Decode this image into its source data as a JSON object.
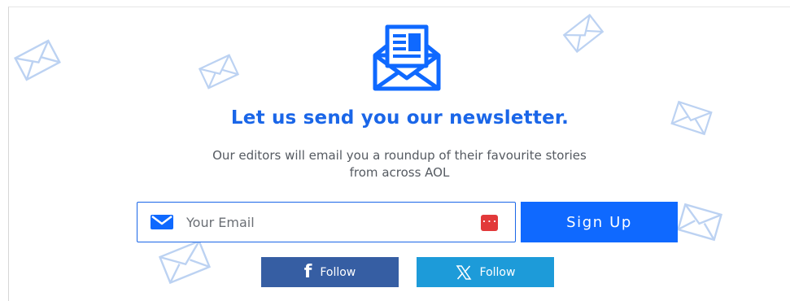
{
  "newsletter": {
    "title": "Let us send you our newsletter.",
    "description": "Our editors will email you a roundup of their favourite stories from across AOL",
    "email_placeholder": "Your Email",
    "password_manager_icon": "dots-icon",
    "signup_label": "Sign Up"
  },
  "social": {
    "facebook_label": "Follow",
    "x_label": "Follow"
  },
  "colors": {
    "accent": "#1a66e8",
    "signup_bg": "#0f69ff",
    "facebook_bg": "#365ea3",
    "x_bg": "#1d9bd9",
    "bg_envelopes": "#bcd2f2",
    "password_icon": "#e2393a"
  },
  "icons": {
    "hero": "newsletter-envelope-icon",
    "field": "mail-icon",
    "facebook": "facebook-icon",
    "x": "x-logo-icon",
    "background": "envelope-outline-icon"
  }
}
